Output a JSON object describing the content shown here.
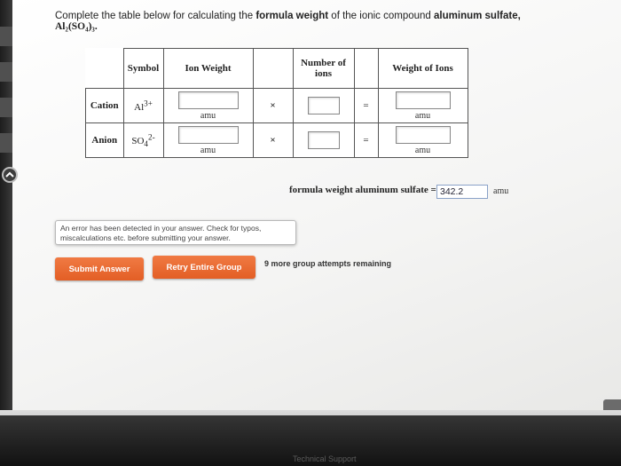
{
  "question": {
    "prefix": "Complete the table below for calculating the",
    "bold1": "formula weight",
    "middle": "of the ionic compound",
    "bold2": "aluminum sulfate,",
    "formula": "Al₂(SO₄)₃."
  },
  "table": {
    "headers": [
      "Symbol",
      "Ion Weight",
      "Number of ions",
      "Weight of Ions"
    ],
    "rows": [
      {
        "label": "Cation",
        "symbol_base": "Al",
        "symbol_sup": "3+",
        "symbol_sub": "",
        "ion_weight": "",
        "ion_unit": "amu",
        "operator": "×",
        "number": "",
        "equals": "=",
        "weight_unit": "amu"
      },
      {
        "label": "Anion",
        "symbol_base": "SO",
        "symbol_sub": "4",
        "symbol_sup": "2-",
        "ion_weight": "",
        "ion_unit": "amu",
        "operator": "×",
        "number": "",
        "equals": "=",
        "weight_unit": "amu"
      }
    ]
  },
  "formula_weight": {
    "label": "formula weight aluminum sulfate =",
    "value": "342.2",
    "unit": "amu"
  },
  "error_message": "An error has been detected in your answer. Check for typos, miscalculations etc. before submitting your answer.",
  "buttons": {
    "submit": "Submit Answer",
    "retry": "Retry Entire Group"
  },
  "attempts_text": "9 more group attempts remaining",
  "footer": {
    "support": "Technical Support"
  },
  "colors": {
    "button_orange": "#e96a30",
    "input_border": "#8aa2c8"
  }
}
